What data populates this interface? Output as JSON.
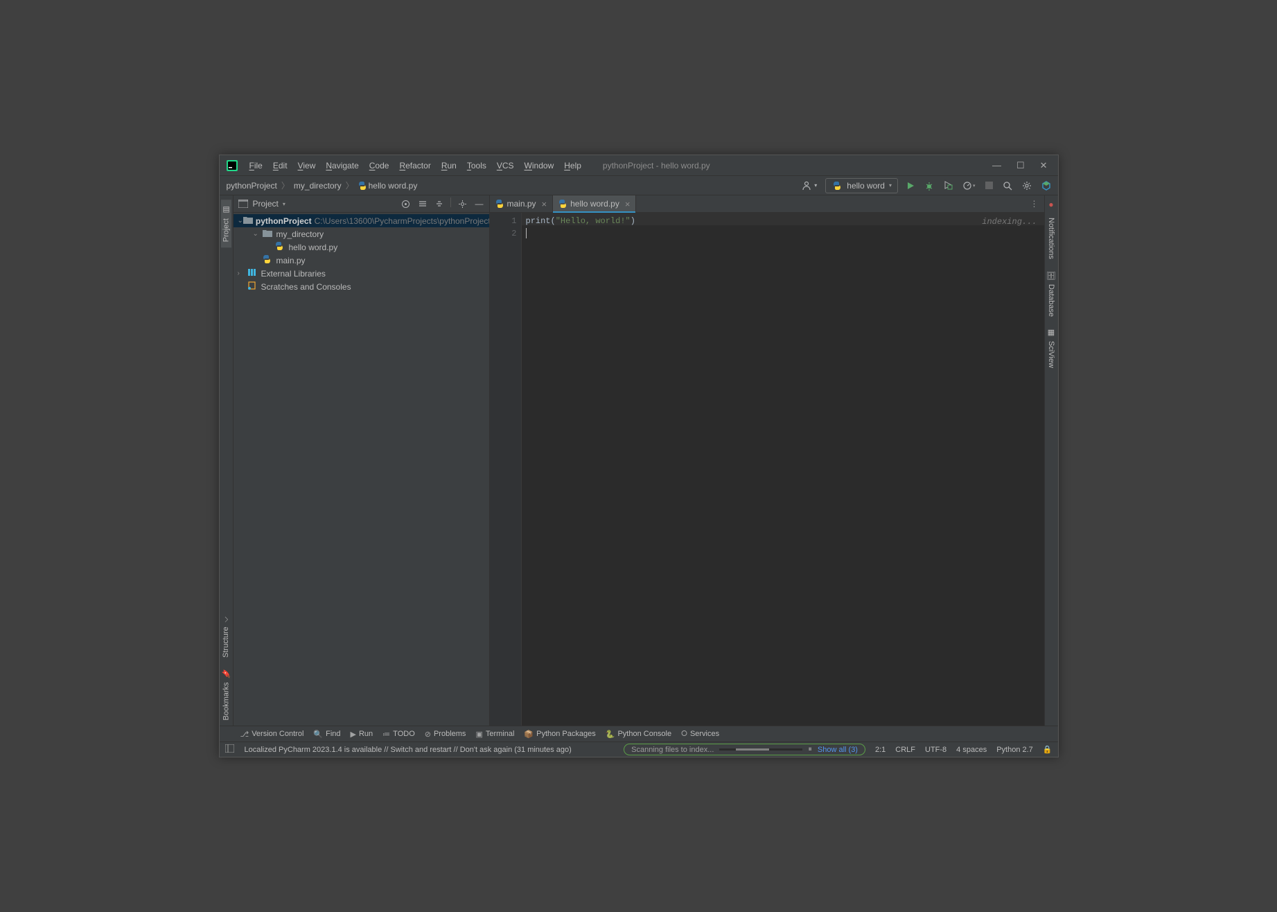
{
  "titlebar": {
    "title": "pythonProject - hello word.py",
    "menu": [
      "File",
      "Edit",
      "View",
      "Navigate",
      "Code",
      "Refactor",
      "Run",
      "Tools",
      "VCS",
      "Window",
      "Help"
    ]
  },
  "breadcrumb": [
    "pythonProject",
    "my_directory",
    "hello word.py"
  ],
  "runconfig": {
    "label": "hello word"
  },
  "project_header": "Project",
  "tree": {
    "root": {
      "name": "pythonProject",
      "path": "C:\\Users\\13600\\PycharmProjects\\pythonProject"
    },
    "dir": "my_directory",
    "file1": "hello word.py",
    "file2": "main.py",
    "extlib": "External Libraries",
    "scratches": "Scratches and Consoles"
  },
  "tabs": [
    {
      "label": "main.py",
      "active": false
    },
    {
      "label": "hello word.py",
      "active": true
    }
  ],
  "editor": {
    "indexing": "indexing...",
    "lines": [
      "1",
      "2"
    ],
    "code": {
      "fn": "print",
      "paren_open": "(",
      "str": "\"Hello, world!\"",
      "paren_close": ")"
    }
  },
  "left_tabs": {
    "project": "Project",
    "structure": "Structure",
    "bookmarks": "Bookmarks"
  },
  "right_tabs": {
    "notifications": "Notifications",
    "database": "Database",
    "sciview": "SciView"
  },
  "bottom_tabs": [
    "Version Control",
    "Find",
    "Run",
    "TODO",
    "Problems",
    "Terminal",
    "Python Packages",
    "Python Console",
    "Services"
  ],
  "status": {
    "msg": "Localized PyCharm 2023.1.4 is available // Switch and restart // Don't ask again (31 minutes ago)",
    "scanning": "Scanning files to index...",
    "showall": "Show all (3)",
    "pos": "2:1",
    "sep": "CRLF",
    "enc": "UTF-8",
    "indent": "4 spaces",
    "py": "Python 2.7"
  }
}
